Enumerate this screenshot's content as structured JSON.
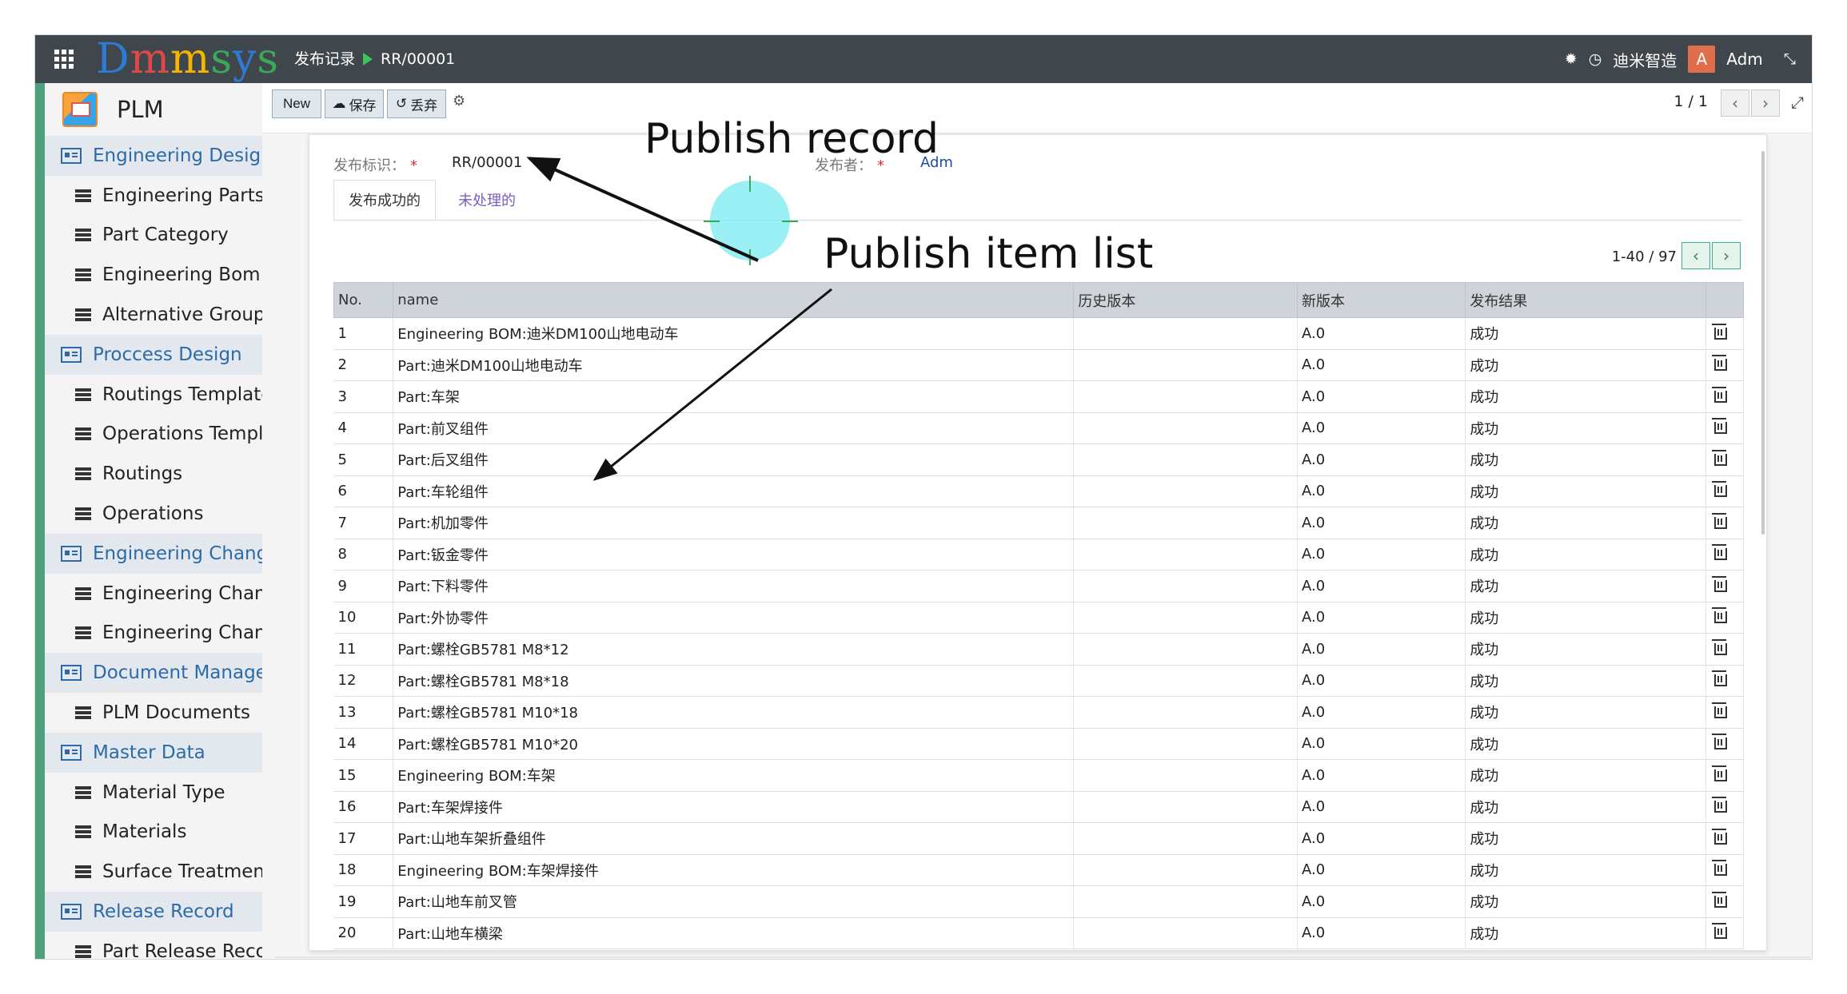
{
  "topbar": {
    "brand": [
      "D",
      "m",
      "m",
      "s",
      "y",
      "s"
    ],
    "breadcrumb": {
      "parent": "发布记录",
      "current": "RR/00001"
    },
    "company": "迪米智造",
    "avatar_letter": "A",
    "user": "Adm",
    "icons": [
      "apps-grid-icon",
      "bug-icon",
      "clock-icon",
      "expand-icon"
    ]
  },
  "sidebar": {
    "app_title": "PLM",
    "menu": [
      {
        "type": "cat",
        "label": "Engineering Design"
      },
      {
        "type": "item",
        "label": "Engineering Parts"
      },
      {
        "type": "item",
        "label": "Part Category"
      },
      {
        "type": "item",
        "label": "Engineering Bom"
      },
      {
        "type": "item",
        "label": "Alternative Group"
      },
      {
        "type": "cat",
        "label": "Proccess Design"
      },
      {
        "type": "item",
        "label": "Routings Template"
      },
      {
        "type": "item",
        "label": "Operations Template"
      },
      {
        "type": "item",
        "label": "Routings"
      },
      {
        "type": "item",
        "label": "Operations"
      },
      {
        "type": "cat",
        "label": "Engineering Change"
      },
      {
        "type": "item",
        "label": "Engineering Change"
      },
      {
        "type": "item",
        "label": "Engineering Change"
      },
      {
        "type": "cat",
        "label": "Document Manage"
      },
      {
        "type": "item",
        "label": "PLM Documents"
      },
      {
        "type": "cat",
        "label": "Master Data"
      },
      {
        "type": "item",
        "label": "Material Type"
      },
      {
        "type": "item",
        "label": "Materials"
      },
      {
        "type": "item",
        "label": "Surface Treatment"
      },
      {
        "type": "cat",
        "label": "Release Record"
      },
      {
        "type": "item",
        "label": "Part Release Record"
      }
    ]
  },
  "control": {
    "new_label": "New",
    "save_label": "保存",
    "discard_label": "丢弃",
    "pager": "1 / 1"
  },
  "form": {
    "id_label": "发布标识：",
    "id_value": "RR/00001",
    "publisher_label": "发布者：",
    "publisher_value": "Adm",
    "tabs": [
      "发布成功的",
      "未处理的"
    ],
    "list_pager": "1-40 / 97",
    "columns": [
      "No.",
      "name",
      "历史版本",
      "新版本",
      "发布结果"
    ],
    "rows": [
      {
        "no": "1",
        "name": "Engineering BOM:迪米DM100山地电动车",
        "old": "",
        "new": "A.0",
        "result": "成功"
      },
      {
        "no": "2",
        "name": "Part:迪米DM100山地电动车",
        "old": "",
        "new": "A.0",
        "result": "成功"
      },
      {
        "no": "3",
        "name": "Part:车架",
        "old": "",
        "new": "A.0",
        "result": "成功"
      },
      {
        "no": "4",
        "name": "Part:前叉组件",
        "old": "",
        "new": "A.0",
        "result": "成功"
      },
      {
        "no": "5",
        "name": "Part:后叉组件",
        "old": "",
        "new": "A.0",
        "result": "成功"
      },
      {
        "no": "6",
        "name": "Part:车轮组件",
        "old": "",
        "new": "A.0",
        "result": "成功"
      },
      {
        "no": "7",
        "name": "Part:机加零件",
        "old": "",
        "new": "A.0",
        "result": "成功"
      },
      {
        "no": "8",
        "name": "Part:钣金零件",
        "old": "",
        "new": "A.0",
        "result": "成功"
      },
      {
        "no": "9",
        "name": "Part:下料零件",
        "old": "",
        "new": "A.0",
        "result": "成功"
      },
      {
        "no": "10",
        "name": "Part:外协零件",
        "old": "",
        "new": "A.0",
        "result": "成功"
      },
      {
        "no": "11",
        "name": "Part:螺栓GB5781 M8*12",
        "old": "",
        "new": "A.0",
        "result": "成功"
      },
      {
        "no": "12",
        "name": "Part:螺栓GB5781 M8*18",
        "old": "",
        "new": "A.0",
        "result": "成功"
      },
      {
        "no": "13",
        "name": "Part:螺栓GB5781 M10*18",
        "old": "",
        "new": "A.0",
        "result": "成功"
      },
      {
        "no": "14",
        "name": "Part:螺栓GB5781 M10*20",
        "old": "",
        "new": "A.0",
        "result": "成功"
      },
      {
        "no": "15",
        "name": "Engineering BOM:车架",
        "old": "",
        "new": "A.0",
        "result": "成功"
      },
      {
        "no": "16",
        "name": "Part:车架焊接件",
        "old": "",
        "new": "A.0",
        "result": "成功"
      },
      {
        "no": "17",
        "name": "Part:山地车架折叠组件",
        "old": "",
        "new": "A.0",
        "result": "成功"
      },
      {
        "no": "18",
        "name": "Engineering BOM:车架焊接件",
        "old": "",
        "new": "A.0",
        "result": "成功"
      },
      {
        "no": "19",
        "name": "Part:山地车前叉管",
        "old": "",
        "new": "A.0",
        "result": "成功"
      },
      {
        "no": "20",
        "name": "Part:山地车横梁",
        "old": "",
        "new": "A.0",
        "result": "成功"
      }
    ]
  },
  "annotations": {
    "record": "Publish record",
    "list": "Publish item list"
  }
}
